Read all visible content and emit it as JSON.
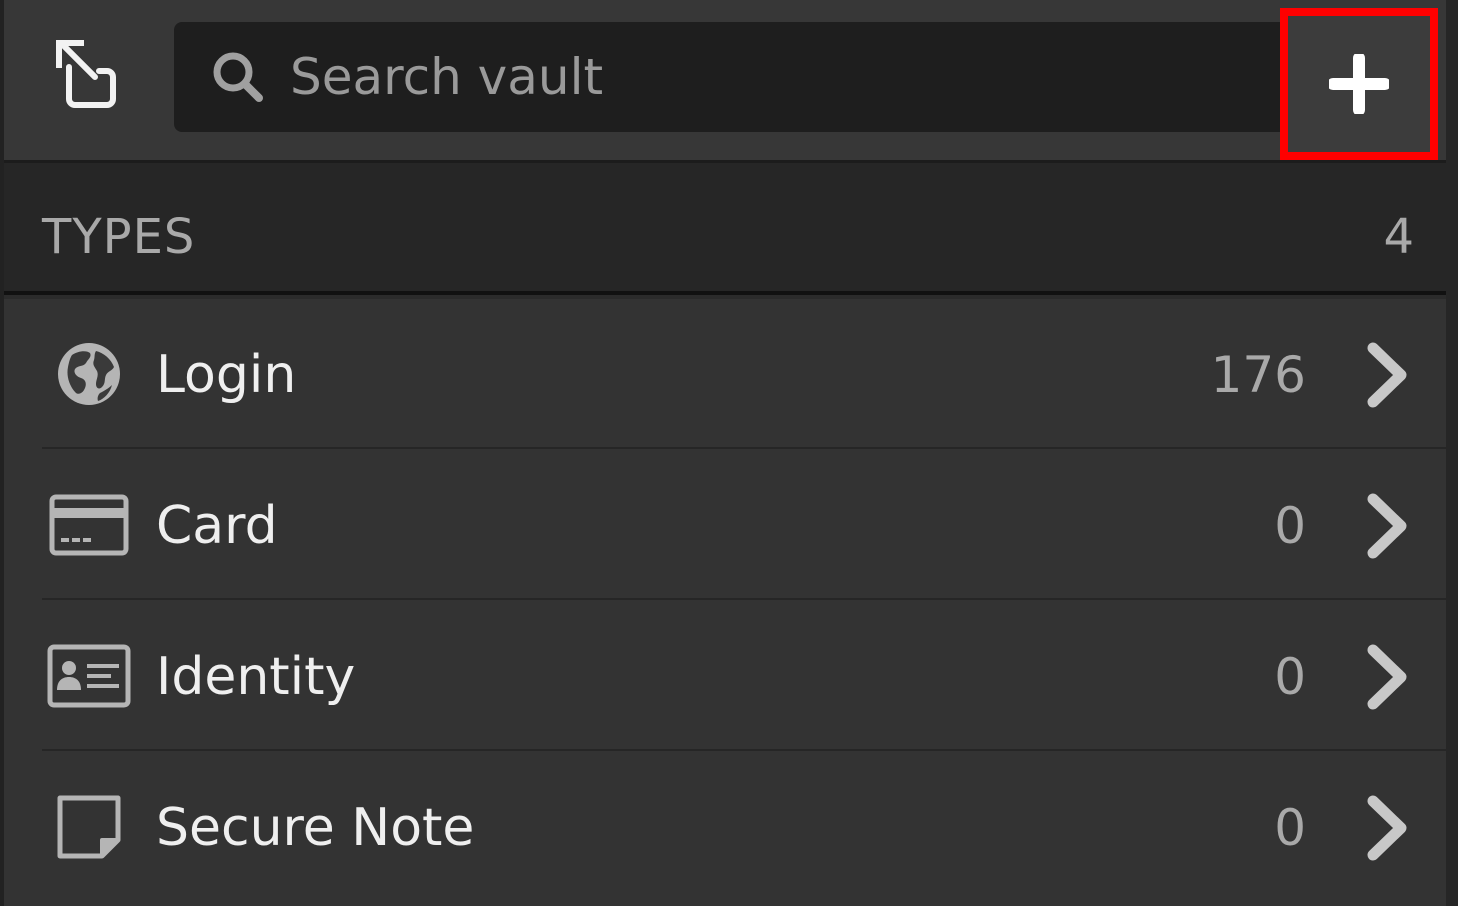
{
  "header": {
    "search_placeholder": "Search vault",
    "popout_icon": "popout-icon",
    "search_icon": "search-icon",
    "add_icon": "plus-icon"
  },
  "types_section": {
    "title": "TYPES",
    "count": "4"
  },
  "types": [
    {
      "label": "Login",
      "count": "176",
      "icon": "globe-icon"
    },
    {
      "label": "Card",
      "count": "0",
      "icon": "credit-card-icon"
    },
    {
      "label": "Identity",
      "count": "0",
      "icon": "id-card-icon"
    },
    {
      "label": "Secure Note",
      "count": "0",
      "icon": "sticky-note-icon"
    }
  ],
  "colors": {
    "header_bg": "#373737",
    "search_bg": "#1e1e1e",
    "list_bg": "#333333",
    "highlight": "#ff0000"
  }
}
